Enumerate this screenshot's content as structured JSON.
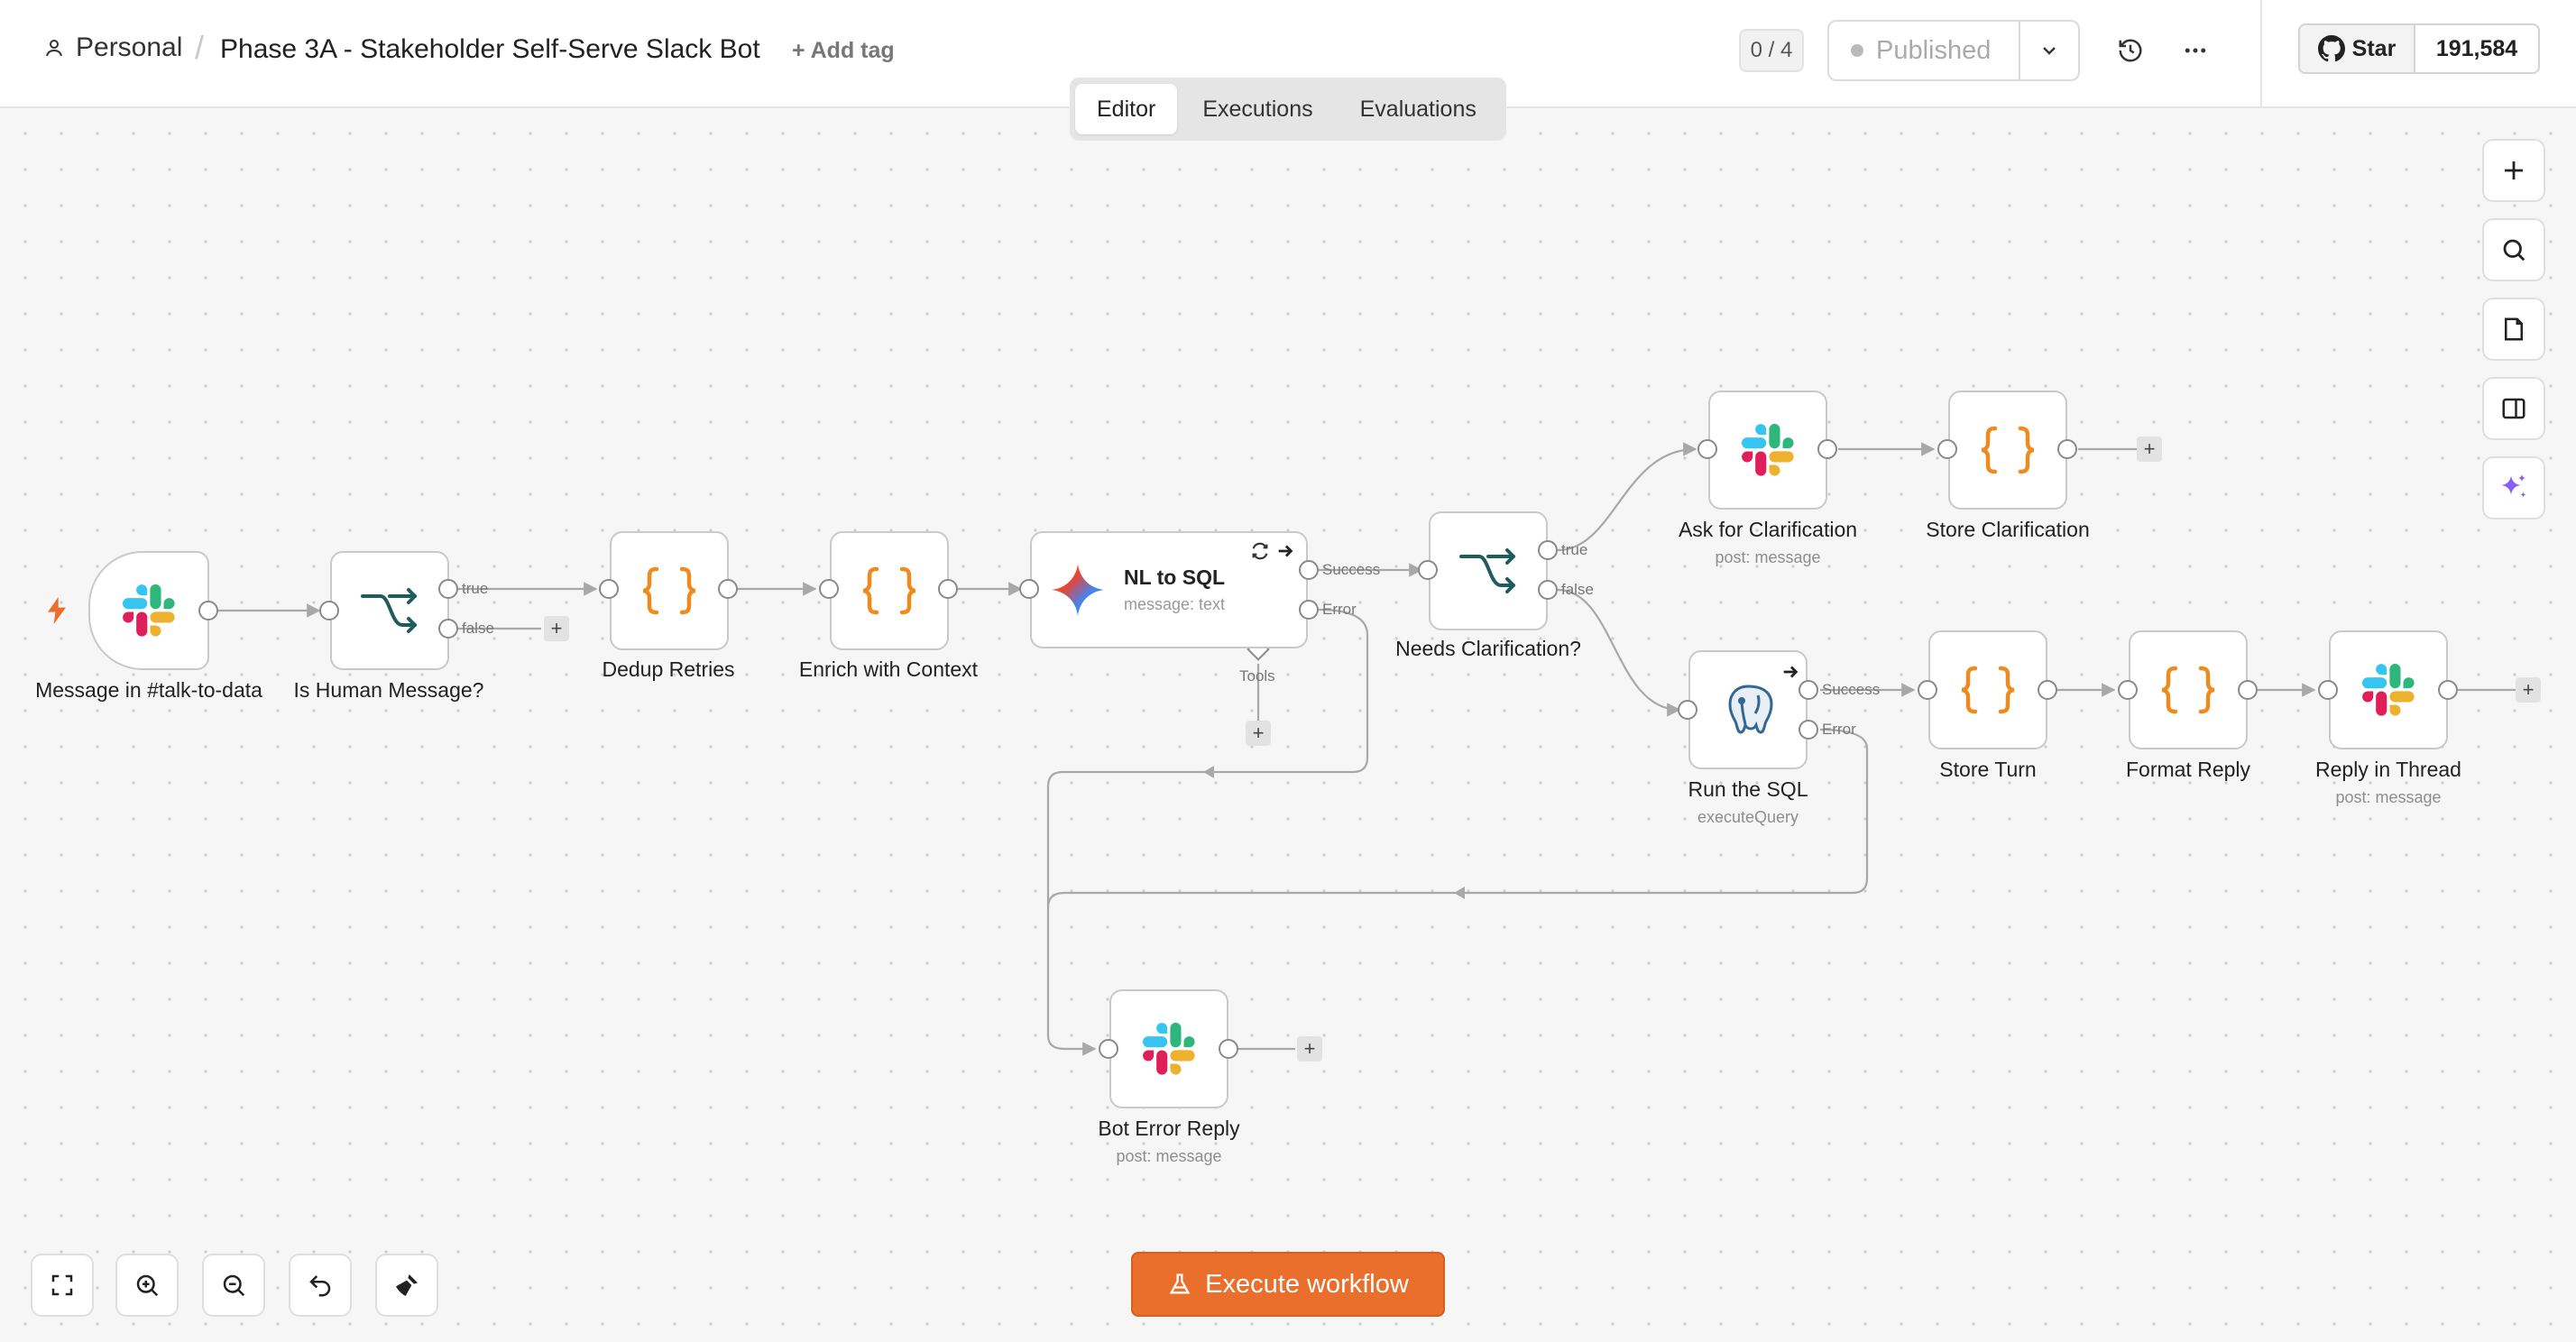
{
  "header": {
    "workspace": "Personal",
    "separator": "/",
    "workflow_title": "Phase 3A - Stakeholder Self-Serve Slack Bot",
    "add_tag": "+ Add tag",
    "counter": "0 / 4",
    "publish_status": "Published",
    "github_star": "Star",
    "github_count": "191,584"
  },
  "tabs": [
    {
      "label": "Editor",
      "active": true
    },
    {
      "label": "Executions",
      "active": false
    },
    {
      "label": "Evaluations",
      "active": false
    }
  ],
  "nodes": {
    "trigger": {
      "label": "Message in #talk-to-data",
      "icon": "slack-icon"
    },
    "is_human": {
      "label": "Is Human Message?",
      "icon": "if-icon"
    },
    "dedup": {
      "label": "Dedup Retries",
      "icon": "code-icon"
    },
    "enrich": {
      "label": "Enrich with Context",
      "icon": "code-icon"
    },
    "nl_to_sql": {
      "label": "NL to SQL",
      "sublabel": "message: text",
      "icon": "gemini-icon"
    },
    "needs_clar": {
      "label": "Needs Clarification?",
      "icon": "if-icon"
    },
    "ask_clar": {
      "label": "Ask for Clarification",
      "sublabel": "post: message",
      "icon": "slack-icon"
    },
    "store_clar": {
      "label": "Store Clarification",
      "icon": "code-icon"
    },
    "run_sql": {
      "label": "Run the SQL",
      "sublabel": "executeQuery",
      "icon": "postgres-icon"
    },
    "store_turn": {
      "label": "Store Turn",
      "icon": "code-icon"
    },
    "format_reply": {
      "label": "Format Reply",
      "icon": "code-icon"
    },
    "reply_thread": {
      "label": "Reply in Thread",
      "sublabel": "post: message",
      "icon": "slack-icon"
    },
    "bot_error": {
      "label": "Bot Error Reply",
      "sublabel": "post: message",
      "icon": "slack-icon"
    }
  },
  "ports": {
    "true": "true",
    "false": "false",
    "success": "Success",
    "error": "Error",
    "tools": "Tools"
  },
  "plus_sign": "+",
  "execute_button": "Execute workflow",
  "colors": {
    "accent": "#ea6f2c",
    "code_brace": "#ee8a1e",
    "if_icon": "#1f5c5e",
    "edge": "#a8a8a8"
  }
}
